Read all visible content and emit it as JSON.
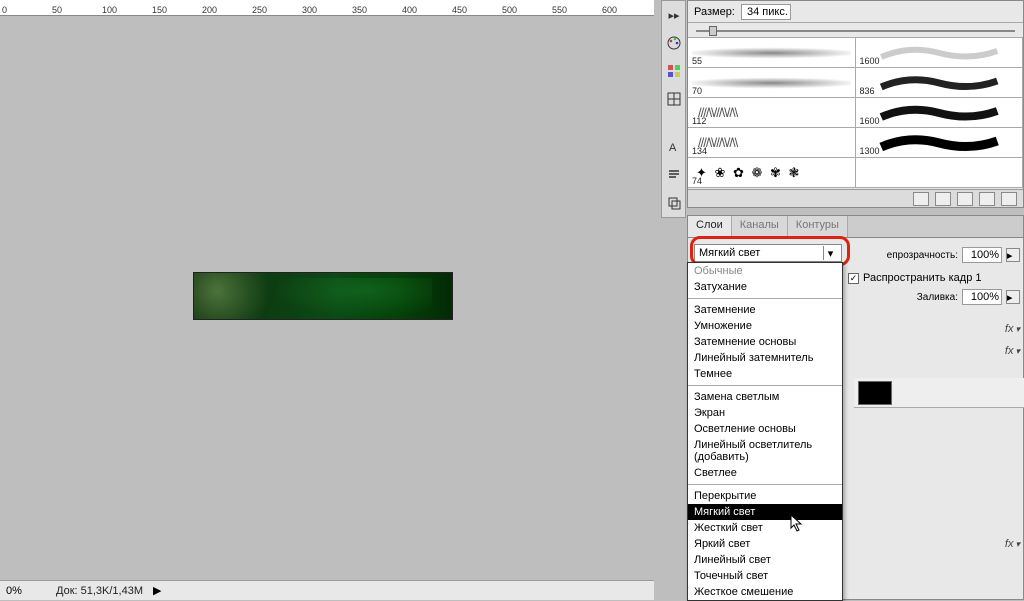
{
  "ruler_marks": [
    "0",
    "50",
    "100",
    "150",
    "200",
    "250",
    "300",
    "350",
    "400",
    "450",
    "500",
    "550",
    "600"
  ],
  "status": {
    "zoom": "0%",
    "doc": "Док: 51,3K/1,43M"
  },
  "brushes_panel": {
    "size_label": "Размер:",
    "size_value": "34 пикс.",
    "brushes": [
      {
        "size": "55",
        "style": "soft"
      },
      {
        "size": "1600",
        "style": "wave-soft"
      },
      {
        "size": "70",
        "style": "soft"
      },
      {
        "size": "836",
        "style": "wave-hard"
      },
      {
        "size": "112",
        "style": "grass"
      },
      {
        "size": "1600",
        "style": "wave-hard"
      },
      {
        "size": "134",
        "style": "grass"
      },
      {
        "size": "1300",
        "style": "wave-hard"
      },
      {
        "size": "74",
        "style": "leaves"
      },
      {
        "size": "",
        "style": ""
      }
    ]
  },
  "layers_panel": {
    "tabs": [
      "Слои",
      "Каналы",
      "Контуры"
    ],
    "blend_mode_selected": "Мягкий свет",
    "opacity_label": "епрозрачность:",
    "opacity_value": "100%",
    "propagate_label": "Распространить кадр 1",
    "fill_label": "Заливка:",
    "fill_value": "100%",
    "fx_label": "fx"
  },
  "blend_modes": {
    "groups": [
      [
        "Обычные",
        "Затухание"
      ],
      [
        "Затемнение",
        "Умножение",
        "Затемнение основы",
        "Линейный затемнитель",
        "Темнее"
      ],
      [
        "Замена светлым",
        "Экран",
        "Осветление основы",
        "Линейный осветлитель (добавить)",
        "Светлее"
      ],
      [
        "Перекрытие",
        "Мягкий свет",
        "Жесткий свет",
        "Яркий свет",
        "Линейный свет",
        "Точечный свет",
        "Жесткое смешение"
      ]
    ],
    "selected": "Мягкий свет"
  }
}
